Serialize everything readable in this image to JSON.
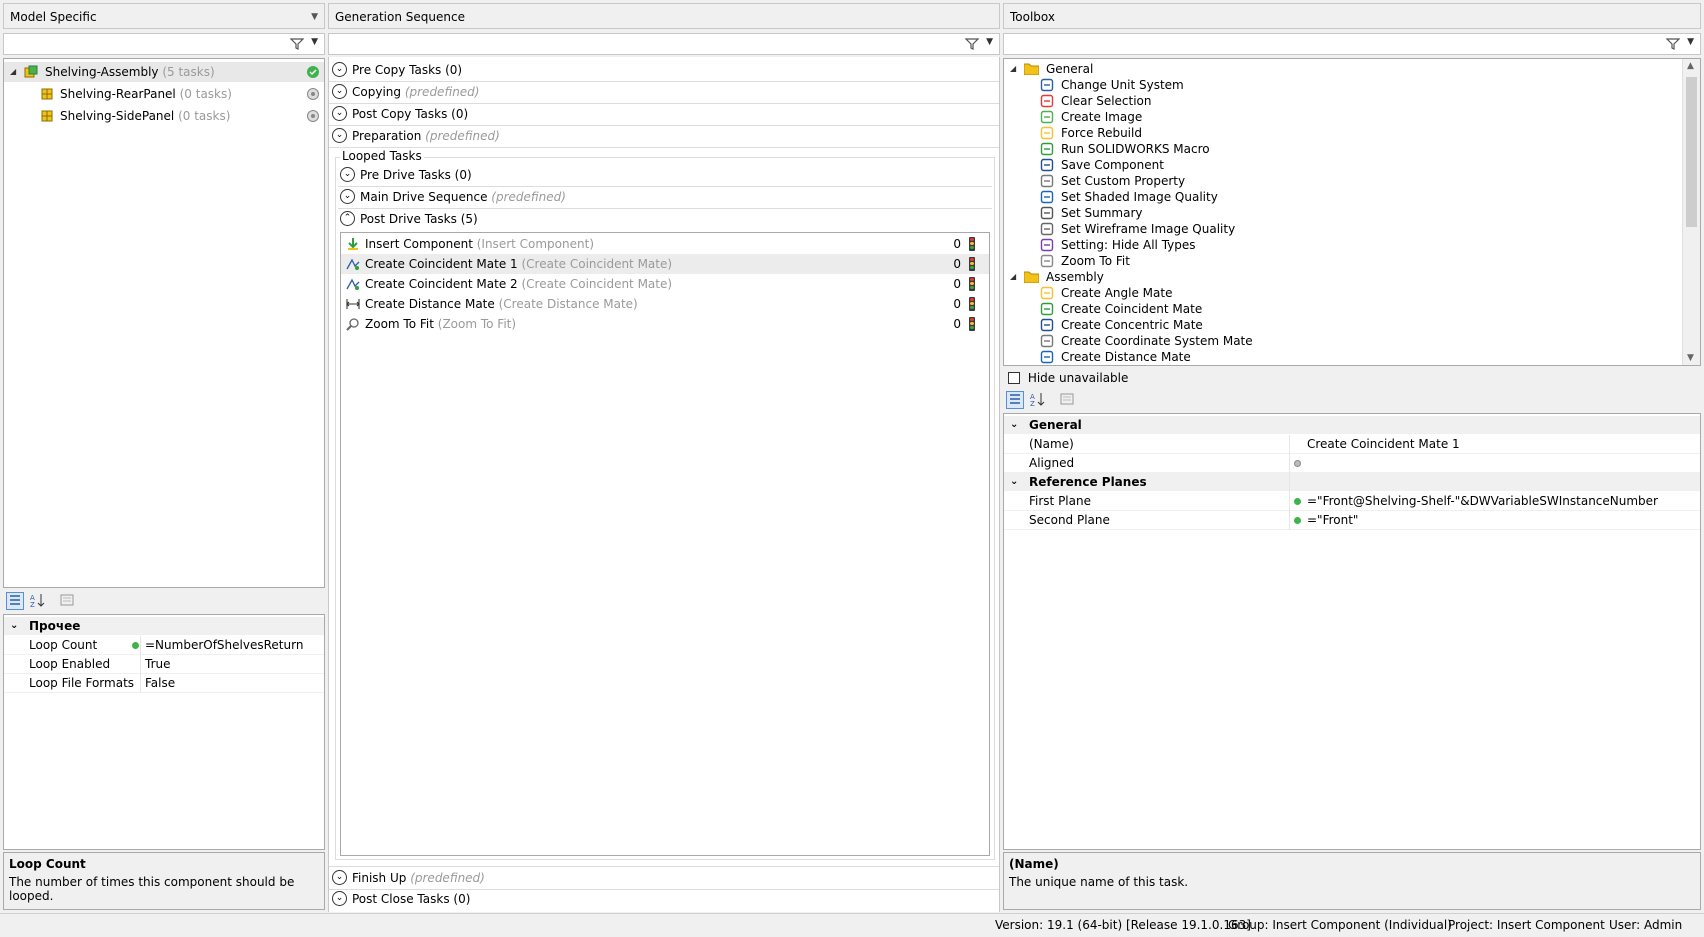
{
  "left": {
    "header": "Model Specific",
    "tree": [
      {
        "name": "Shelving-Assembly",
        "count": "(5 tasks)"
      },
      {
        "name": "Shelving-RearPanel",
        "count": "(0 tasks)"
      },
      {
        "name": "Shelving-SidePanel",
        "count": "(0 tasks)"
      }
    ],
    "props": {
      "category": "Прочее",
      "rows": [
        {
          "name": "Loop Count",
          "value": "=NumberOfShelvesReturn"
        },
        {
          "name": "Loop Enabled",
          "value": "True"
        },
        {
          "name": "Loop File Formats",
          "value": "False"
        }
      ]
    },
    "desc_title": "Loop Count",
    "desc_text": "The number of times this component should be looped."
  },
  "mid": {
    "header": "Generation Sequence",
    "sections_top": [
      {
        "label": "Pre Copy Tasks (0)",
        "note": ""
      },
      {
        "label": "Copying",
        "note": "(predefined)"
      },
      {
        "label": "Post Copy Tasks (0)",
        "note": ""
      },
      {
        "label": "Preparation",
        "note": "(predefined)"
      }
    ],
    "looped_title": "Looped Tasks",
    "looped_sections": [
      {
        "label": "Pre Drive Tasks (0)",
        "note": ""
      },
      {
        "label": "Main Drive Sequence",
        "note": "(predefined)"
      },
      {
        "label": "Post Drive Tasks (5)",
        "note": ""
      }
    ],
    "tasks": [
      {
        "name": "Insert Component",
        "type": "(Insert Component)",
        "count": "0"
      },
      {
        "name": "Create Coincident Mate 1",
        "type": "(Create Coincident Mate)",
        "count": "0"
      },
      {
        "name": "Create Coincident Mate 2",
        "type": "(Create Coincident Mate)",
        "count": "0"
      },
      {
        "name": "Create Distance Mate",
        "type": "(Create Distance Mate)",
        "count": "0"
      },
      {
        "name": "Zoom To Fit",
        "type": "(Zoom To Fit)",
        "count": "0"
      }
    ],
    "sections_bottom": [
      {
        "label": "Finish Up",
        "note": "(predefined)"
      },
      {
        "label": "Post Close Tasks (0)",
        "note": ""
      }
    ]
  },
  "right": {
    "header": "Toolbox",
    "groups": [
      {
        "name": "General",
        "items": [
          "Change Unit System",
          "Clear Selection",
          "Create Image",
          "Force Rebuild",
          "Run SOLIDWORKS Macro",
          "Save Component",
          "Set Custom Property",
          "Set Shaded Image Quality",
          "Set Summary",
          "Set Wireframe Image Quality",
          "Setting: Hide All Types",
          "Zoom To Fit"
        ]
      },
      {
        "name": "Assembly",
        "items": [
          "Create Angle Mate",
          "Create Coincident Mate",
          "Create Concentric Mate",
          "Create Coordinate System Mate",
          "Create Distance Mate"
        ]
      }
    ],
    "hide_unavailable": "Hide unavailable",
    "props": {
      "cat1": "General",
      "rows1": [
        {
          "name": "(Name)",
          "value": "Create Coincident Mate 1"
        },
        {
          "name": "Aligned",
          "value": ""
        }
      ],
      "cat2": "Reference Planes",
      "rows2": [
        {
          "name": "First Plane",
          "value": "=\"Front@Shelving-Shelf-\"&DWVariableSWInstanceNumber"
        },
        {
          "name": "Second Plane",
          "value": "=\"Front\""
        }
      ]
    },
    "desc_title": "(Name)",
    "desc_text": "The unique name of this task."
  },
  "status": {
    "version": "Version: 19.1 (64-bit) [Release 19.1.0.163]",
    "group": "Group: Insert Component (Individual)",
    "project": "Project: Insert Component",
    "user": "User: Admin"
  }
}
